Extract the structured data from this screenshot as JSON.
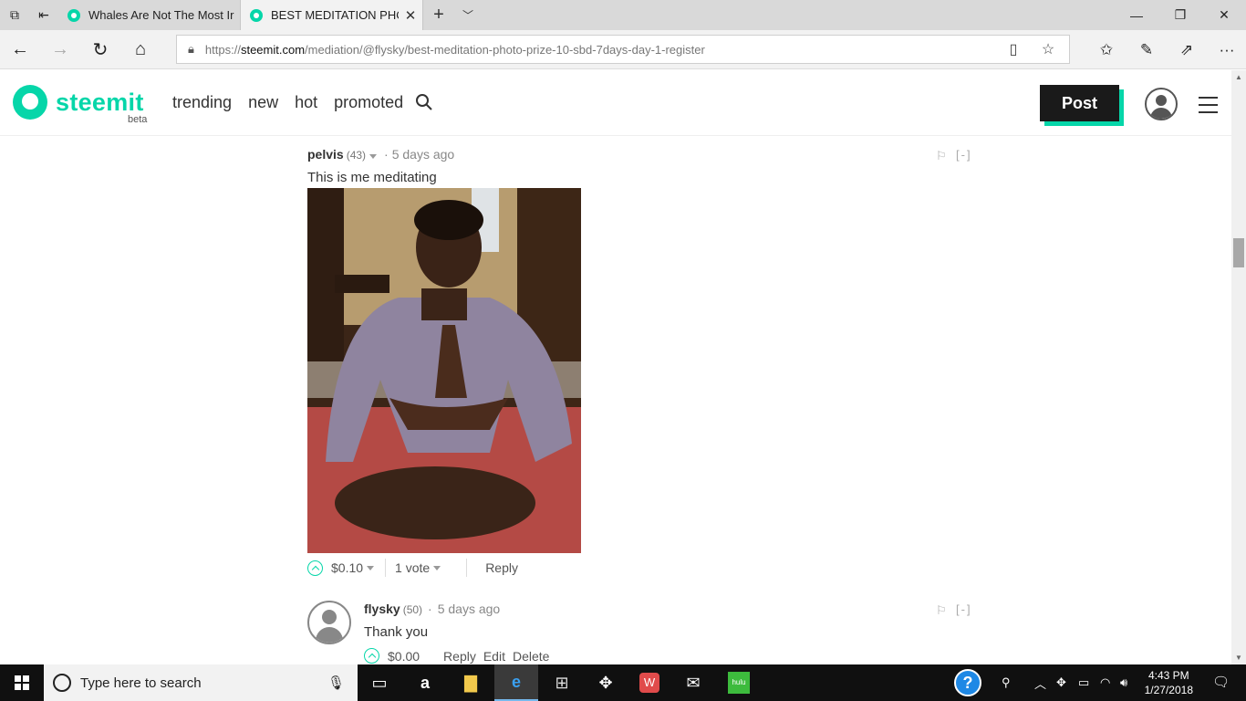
{
  "browser": {
    "tabs": [
      {
        "title": "Whales Are Not The Most Ir",
        "active": false
      },
      {
        "title": "BEST MEDITATION PHO",
        "active": true
      }
    ],
    "close_glyph": "✕",
    "new_tab_glyph": "+",
    "url_scheme": "https://",
    "url_host": "steemit.com",
    "url_path": "/mediation/@flysky/best-meditation-photo-prize-10-sbd-7days-day-1-register"
  },
  "site": {
    "logo_text": "steemit",
    "beta_label": "beta",
    "nav": [
      "trending",
      "new",
      "hot",
      "promoted"
    ],
    "post_label": "Post",
    "accent": "#06d6a9"
  },
  "comments": [
    {
      "author": "pelvis",
      "reputation": "(43)",
      "time": "5 days ago",
      "body": "This is me meditating",
      "payout": "$0.10",
      "votes": "1 vote",
      "reply": "Reply",
      "collapse": "[-]"
    },
    {
      "author": "flysky",
      "reputation": "(50)",
      "time": "5 days ago",
      "body": "Thank you",
      "payout": "$0.00",
      "reply": "Reply",
      "edit": "Edit",
      "delete": "Delete",
      "collapse": "[-]"
    }
  ],
  "taskbar": {
    "search_placeholder": "Type here to search",
    "time": "4:43 PM",
    "date": "1/27/2018",
    "hulu_label": "hulu"
  }
}
